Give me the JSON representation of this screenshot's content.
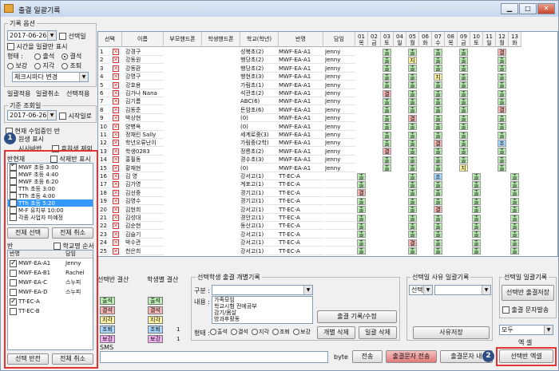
{
  "window": {
    "title": "출결 일괄기록",
    "min_icon": "minimize-icon",
    "max_icon": "maximize-icon",
    "close_icon": "close-icon"
  },
  "record_options": {
    "group_label": "기록 옵션",
    "date": "2017-06-26",
    "selected_day_label": "선택일",
    "time_only_label": "시간을 일괄만 표시",
    "state_label": "형태 :",
    "states": [
      "출석",
      "결석",
      "보강",
      "지각",
      "조퇴"
    ],
    "selected_state": "결석",
    "change_select": "체크시마다 변경",
    "btn_bulk_apply": "일괄적용",
    "btn_bulk_cancel": "일괄취소",
    "btn_select_apply": "선택적용"
  },
  "query": {
    "group_label": "기준 조회일",
    "date": "2017-06-26",
    "start_day_label": "시작일로",
    "current_class_label": "현재 수업중인 반",
    "student_show_label": "원생 표시",
    "sub_label": "시사바반",
    "exclude_label": "휴원생 제외"
  },
  "class_list": {
    "title": "반현재",
    "deleted_label": "삭제반 표시",
    "items": [
      {
        "label": "MWF 초등 3:00",
        "checked": true,
        "selected": false
      },
      {
        "label": "MWF 초등 4:40",
        "checked": false,
        "selected": false
      },
      {
        "label": "MWF 초등 6:20",
        "checked": false,
        "selected": false
      },
      {
        "label": "TTh 초등 3:00",
        "checked": false,
        "selected": false
      },
      {
        "label": "TTh 초등 4:00",
        "checked": false,
        "selected": false
      },
      {
        "label": "TTh 초등 5:20",
        "checked": false,
        "selected": true
      },
      {
        "label": "M-F 유치부 10:00",
        "checked": false,
        "selected": false
      },
      {
        "label": "각종 사업자 미예정",
        "checked": false,
        "selected": false
      }
    ],
    "btn_select_all": "전체 선택",
    "btn_cancel_all": "전체 취소"
  },
  "ban": {
    "label": "반",
    "school_order_label": "학교명 순서",
    "col_class": "반명",
    "col_teacher": "담임",
    "rows": [
      {
        "name": "MWF-EA-A1",
        "teacher": "Jenny",
        "checked": true
      },
      {
        "name": "MWF-EA-B1",
        "teacher": "Rachel",
        "checked": false
      },
      {
        "name": "MWF-EA-C",
        "teacher": "스누피",
        "checked": false
      },
      {
        "name": "MWF-EA-D",
        "teacher": "스누피",
        "checked": false
      },
      {
        "name": "TT-EC-A",
        "teacher": "",
        "checked": true
      },
      {
        "name": "TT-EC-B",
        "teacher": "",
        "checked": false
      }
    ],
    "btn_select_reverse": "선택 반전",
    "btn_cancel_all": "전체 취소"
  },
  "grid": {
    "headers": {
      "select": "선택",
      "name": "이름",
      "parent_phone": "부모핸드폰",
      "student_phone": "학생핸드폰",
      "school": "학교(학년)",
      "class": "반명",
      "teacher": "담임"
    },
    "days": [
      {
        "d": "01",
        "w": "목"
      },
      {
        "d": "02",
        "w": "금"
      },
      {
        "d": "03",
        "w": "토"
      },
      {
        "d": "04",
        "w": "일"
      },
      {
        "d": "05",
        "w": "월"
      },
      {
        "d": "06",
        "w": "화"
      },
      {
        "d": "07",
        "w": "수"
      },
      {
        "d": "08",
        "w": "목"
      },
      {
        "d": "09",
        "w": "금"
      },
      {
        "d": "10",
        "w": "토"
      },
      {
        "d": "11",
        "w": "일"
      },
      {
        "d": "12",
        "w": "월"
      },
      {
        "d": "13",
        "w": "화"
      }
    ],
    "rows": [
      {
        "no": "1",
        "name": "강경구",
        "school": "성북초(2)",
        "cls": "MWF-EA-A1",
        "teacher": "Jenny"
      },
      {
        "no": "2",
        "name": "강동원",
        "school": "행당초(2)",
        "cls": "MWF-EA-A1",
        "teacher": "Jenny"
      },
      {
        "no": "3",
        "name": "강동환",
        "school": "행당초(2)",
        "cls": "MWF-EA-A1",
        "teacher": "Jenny"
      },
      {
        "no": "4",
        "name": "강명구",
        "school": "행현초(3)",
        "cls": "MWF-EA-A1",
        "teacher": "Jenny"
      },
      {
        "no": "5",
        "name": "강호용",
        "school": "가림초(1)",
        "cls": "MWF-EA-A1",
        "teacher": "Jenny"
      },
      {
        "no": "6",
        "name": "김가나 Nana",
        "school": "석관초(2)",
        "cls": "MWF-EA-A1",
        "teacher": "Jenny"
      },
      {
        "no": "7",
        "name": "김기름",
        "school": "ABC(6)",
        "cls": "MWF-EA-A1",
        "teacher": "Jenny"
      },
      {
        "no": "8",
        "name": "김동준",
        "school": "돈암초(6)",
        "cls": "MWF-EA-A1",
        "teacher": "Jenny"
      },
      {
        "no": "9",
        "name": "박상현",
        "school": "(0)",
        "cls": "MWF-EA-A1",
        "teacher": "Jenny"
      },
      {
        "no": "10",
        "name": "양병옥",
        "school": "(0)",
        "cls": "MWF-EA-A1",
        "teacher": "Jenny"
      },
      {
        "no": "11",
        "name": "정채린 Sally",
        "school": "세계로중(3)",
        "cls": "MWF-EA-A1",
        "teacher": "Jenny"
      },
      {
        "no": "12",
        "name": "학년오류난이",
        "school": "가림중(2학)",
        "cls": "MWF-EA-A1",
        "teacher": "Jenny"
      },
      {
        "no": "13",
        "name": "학생0283",
        "school": "정릉초(2)",
        "cls": "MWF-EA-A1",
        "teacher": "Jenny"
      },
      {
        "no": "14",
        "name": "홍필동",
        "school": "경수초(3)",
        "cls": "MWF-EA-A1",
        "teacher": "Jenny"
      },
      {
        "no": "15",
        "name": "황재현",
        "school": "(0)",
        "cls": "MWF-EA-A1",
        "teacher": "Jenny"
      },
      {
        "no": "16",
        "name": "김 영",
        "school": "강서고(1)",
        "cls": "TT-EC-A",
        "teacher": ""
      },
      {
        "no": "17",
        "name": "김가영",
        "school": "계포고(1)",
        "cls": "TT-EC-A",
        "teacher": ""
      },
      {
        "no": "18",
        "name": "김선중",
        "school": "경기고(1)",
        "cls": "TT-EC-A",
        "teacher": ""
      },
      {
        "no": "19",
        "name": "김영수",
        "school": "경기고(1)",
        "cls": "TT-EC-A",
        "teacher": ""
      },
      {
        "no": "20",
        "name": "김현희",
        "school": "강서고(1)",
        "cls": "TT-EC-A",
        "teacher": ""
      },
      {
        "no": "21",
        "name": "김성대",
        "school": "경안고(1)",
        "cls": "TT-EC-A",
        "teacher": ""
      },
      {
        "no": "22",
        "name": "김순현",
        "school": "동산고(1)",
        "cls": "TT-EC-A",
        "teacher": ""
      },
      {
        "no": "23",
        "name": "김슬기",
        "school": "강서고(1)",
        "cls": "TT-EC-A",
        "teacher": ""
      },
      {
        "no": "24",
        "name": "박수관",
        "school": "강서고(1)",
        "cls": "TT-EC-A",
        "teacher": ""
      },
      {
        "no": "25",
        "name": "천은희",
        "school": "강서고(1)",
        "cls": "TT-EC-A",
        "teacher": ""
      }
    ],
    "marks": [
      "..O.O.O.O..G.",
      "..O.J.O.O..O.",
      "..O.O.O.O..O.",
      "..O.O.J.O..O.",
      "..O.O.O.O..O.",
      "..G.O.O.O..O.",
      "..O.O.O.O..O.",
      "..O.O.O.O..G.",
      "..O.G.O.O..O.",
      "..O.O.O.O..O.",
      "..O.O.O.O..O.",
      "..O.O.G.O..B.",
      "..G.O.O.O..O.",
      "..O.O.O.O..O.",
      "..O.O.O.J..O.",
      "O...O.B..O..O",
      "O...O.O..O..O",
      "G...O.O..O..O",
      "O...O.O..O..O",
      "O...O.G..O..O",
      "O...O.O..O..O",
      "O...O.O..O..O",
      "O...O.O..O..O",
      "O...G.O..O..O",
      "O...O.O..O..O"
    ],
    "mark_labels": {
      "O": "출",
      "G": "결",
      "J": "지",
      "B": "조"
    },
    "mark_colors": {
      "O": "#b8ecb0",
      "G": "#f7b4b4",
      "J": "#fbf2a0",
      "B": "#a8d8ff"
    }
  },
  "legend": {
    "selected_title": "선택반 결산",
    "student_title": "학생별 결산",
    "items": [
      {
        "label": "출석",
        "color": "#b8ecb0"
      },
      {
        "label": "결석",
        "color": "#f7b4b4"
      },
      {
        "label": "지각",
        "color": "#fbf2a0"
      },
      {
        "label": "조퇴",
        "color": "#a8d8ff"
      },
      {
        "label": "보강",
        "color": "#f0b0f0"
      }
    ],
    "student_counts": [
      "",
      "",
      "",
      "1",
      "1"
    ]
  },
  "individual": {
    "title": "선택학생 출결 개별기록",
    "type_label": "구분 :",
    "content_label": "내용 :",
    "content_lines": [
      "가족모임",
      "학교시험 전에공부",
      "감기/몸살",
      "방과후활동"
    ],
    "state_label": "형태 :",
    "states": [
      "출석",
      "결석",
      "지각",
      "조퇴",
      "보강"
    ],
    "btn_record": "출결 기록/수정",
    "btn_delete_one": "개별 삭제",
    "btn_delete_bulk": "일괄 삭제"
  },
  "reason": {
    "title": "선택일 사유 일괄기록",
    "select_value": "선택",
    "btn_save": "사유저장"
  },
  "bulk_day": {
    "title": "선택일 일괄기록",
    "btn_save": "선택반 출결저장",
    "sms_label": "출결 문자발송"
  },
  "export": {
    "select_value": "모두",
    "excel_label": "엑 셀",
    "btn_excel": "선택반 엑셀"
  },
  "sms": {
    "label": "SMS",
    "byte_label": "byte",
    "btn_send": "전송",
    "btn_attend_sms": "출결문자 전송",
    "btn_attend_content": "출결문자 내"
  },
  "annotations": {
    "c1": "1",
    "c2": "2"
  }
}
